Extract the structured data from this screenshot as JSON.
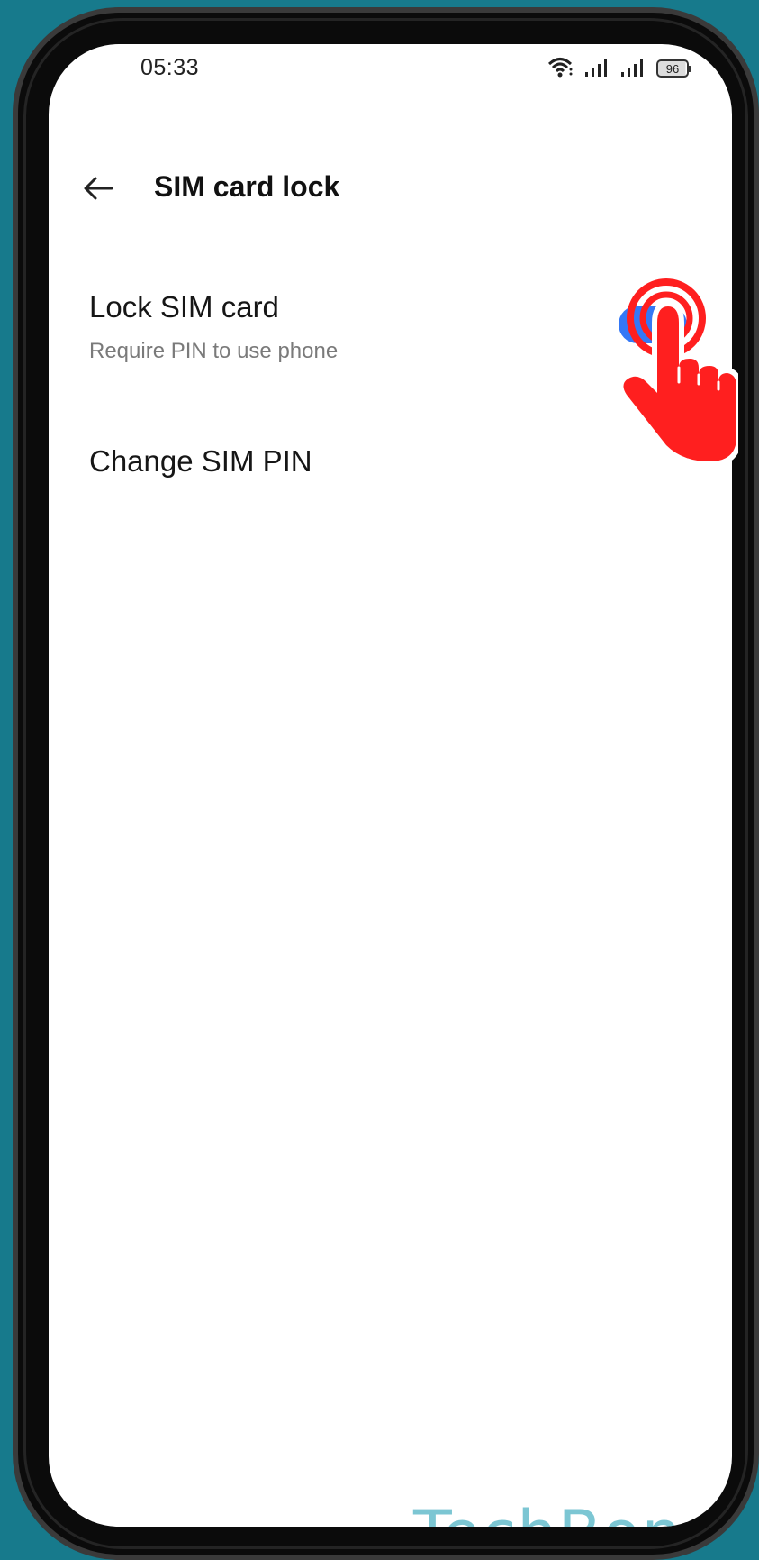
{
  "status_bar": {
    "time": "05:33",
    "battery_level": "96",
    "icons": [
      "wifi-icon",
      "signal-icon",
      "signal-icon",
      "battery-icon"
    ]
  },
  "header": {
    "back_icon": "arrow-left-icon",
    "title": "SIM card lock"
  },
  "settings": {
    "lock_sim": {
      "title": "Lock SIM card",
      "subtitle": "Require PIN to use phone",
      "enabled": true
    },
    "change_pin": {
      "title": "Change SIM PIN"
    }
  },
  "overlay": {
    "icon": "tap-hand-icon",
    "color": "#ff1f1f"
  },
  "watermark": {
    "text": "TechBone",
    "color": "#7cc6d3"
  },
  "colors": {
    "background": "#177a8c",
    "toggle_on": "#3478f6"
  }
}
